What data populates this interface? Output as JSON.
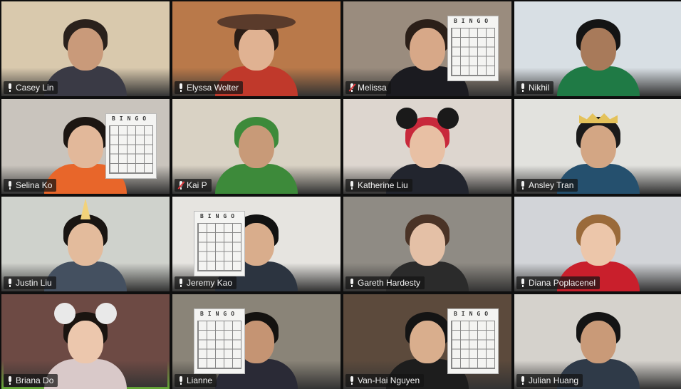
{
  "meeting": {
    "participants": [
      {
        "name": "Casey Lin",
        "muted": false,
        "speaking": false,
        "wall": "#d9c9ad",
        "hair": "#2a211c",
        "skin": "#c99a7a",
        "shirt": "#3a3a45",
        "prop": "none"
      },
      {
        "name": "Elyssa Wolter",
        "muted": false,
        "speaking": false,
        "wall": "#b9794a",
        "hair": "#2a1d16",
        "skin": "#e0b292",
        "shirt": "#c0392b",
        "prop": "hat"
      },
      {
        "name": "Melissa",
        "muted": true,
        "speaking": false,
        "wall": "#9a8c7e",
        "hair": "#2b1f18",
        "skin": "#d7a888",
        "shirt": "#1b1b20",
        "prop": "card-right"
      },
      {
        "name": "Nikhil",
        "muted": false,
        "speaking": false,
        "wall": "#d8dfe4",
        "hair": "#141414",
        "skin": "#a87a5a",
        "shirt": "#1f7a45",
        "prop": "none"
      },
      {
        "name": "Selina Ko",
        "muted": false,
        "speaking": false,
        "wall": "#c9c4bd",
        "hair": "#1c1612",
        "skin": "#e2b89a",
        "shirt": "#e8662a",
        "prop": "card-right"
      },
      {
        "name": "Kai P",
        "muted": true,
        "speaking": false,
        "wall": "#d9d2c4",
        "hair": "#3d8a3a",
        "skin": "#c89a78",
        "shirt": "#3d8a3a",
        "prop": "none"
      },
      {
        "name": "Katherine Liu",
        "muted": false,
        "speaking": false,
        "wall": "#ddd6cf",
        "hair": "#c8293b",
        "skin": "#e8c0a4",
        "shirt": "#22252e",
        "prop": "ears"
      },
      {
        "name": "Ansley Tran",
        "muted": false,
        "speaking": false,
        "wall": "#e2e2de",
        "hair": "#1a1a1a",
        "skin": "#d3a684",
        "shirt": "#25506e",
        "prop": "crown"
      },
      {
        "name": "Justin Liu",
        "muted": false,
        "speaking": false,
        "wall": "#cfd2cc",
        "hair": "#191512",
        "skin": "#e3bb9c",
        "shirt": "#445060",
        "prop": "unicorn"
      },
      {
        "name": "Jeremy Kao",
        "muted": false,
        "speaking": false,
        "wall": "#e6e4e0",
        "hair": "#111111",
        "skin": "#d9ad8c",
        "shirt": "#2c3440",
        "prop": "card-left"
      },
      {
        "name": "Gareth Hardesty",
        "muted": false,
        "speaking": false,
        "wall": "#8f8b84",
        "hair": "#4a3326",
        "skin": "#e4c0a6",
        "shirt": "#2b2b2b",
        "prop": "none"
      },
      {
        "name": "Diana Poplacenel",
        "muted": false,
        "speaking": false,
        "wall": "#d2d4d8",
        "hair": "#9a6a3a",
        "skin": "#ecc6aa",
        "shirt": "#c91f2c",
        "prop": "none"
      },
      {
        "name": "Briana Do",
        "muted": false,
        "speaking": true,
        "wall": "#6d4a44",
        "hair": "#1a1410",
        "skin": "#ecc7ad",
        "shirt": "#d9c9c9",
        "prop": "ears-white"
      },
      {
        "name": "Lianne",
        "muted": false,
        "speaking": false,
        "wall": "#8a8478",
        "hair": "#141210",
        "skin": "#c59473",
        "shirt": "#2a2a36",
        "prop": "card-left"
      },
      {
        "name": "Van-Hai Nguyen",
        "muted": false,
        "speaking": false,
        "wall": "#5c4a3c",
        "hair": "#141414",
        "skin": "#d9ae8d",
        "shirt": "#1d1d1d",
        "prop": "card-right"
      },
      {
        "name": "Julian Huang",
        "muted": false,
        "speaking": false,
        "wall": "#d5d2cc",
        "hair": "#141414",
        "skin": "#c99a78",
        "shirt": "#2f3a48",
        "prop": "none"
      }
    ],
    "bingo_title": "BINGO"
  }
}
